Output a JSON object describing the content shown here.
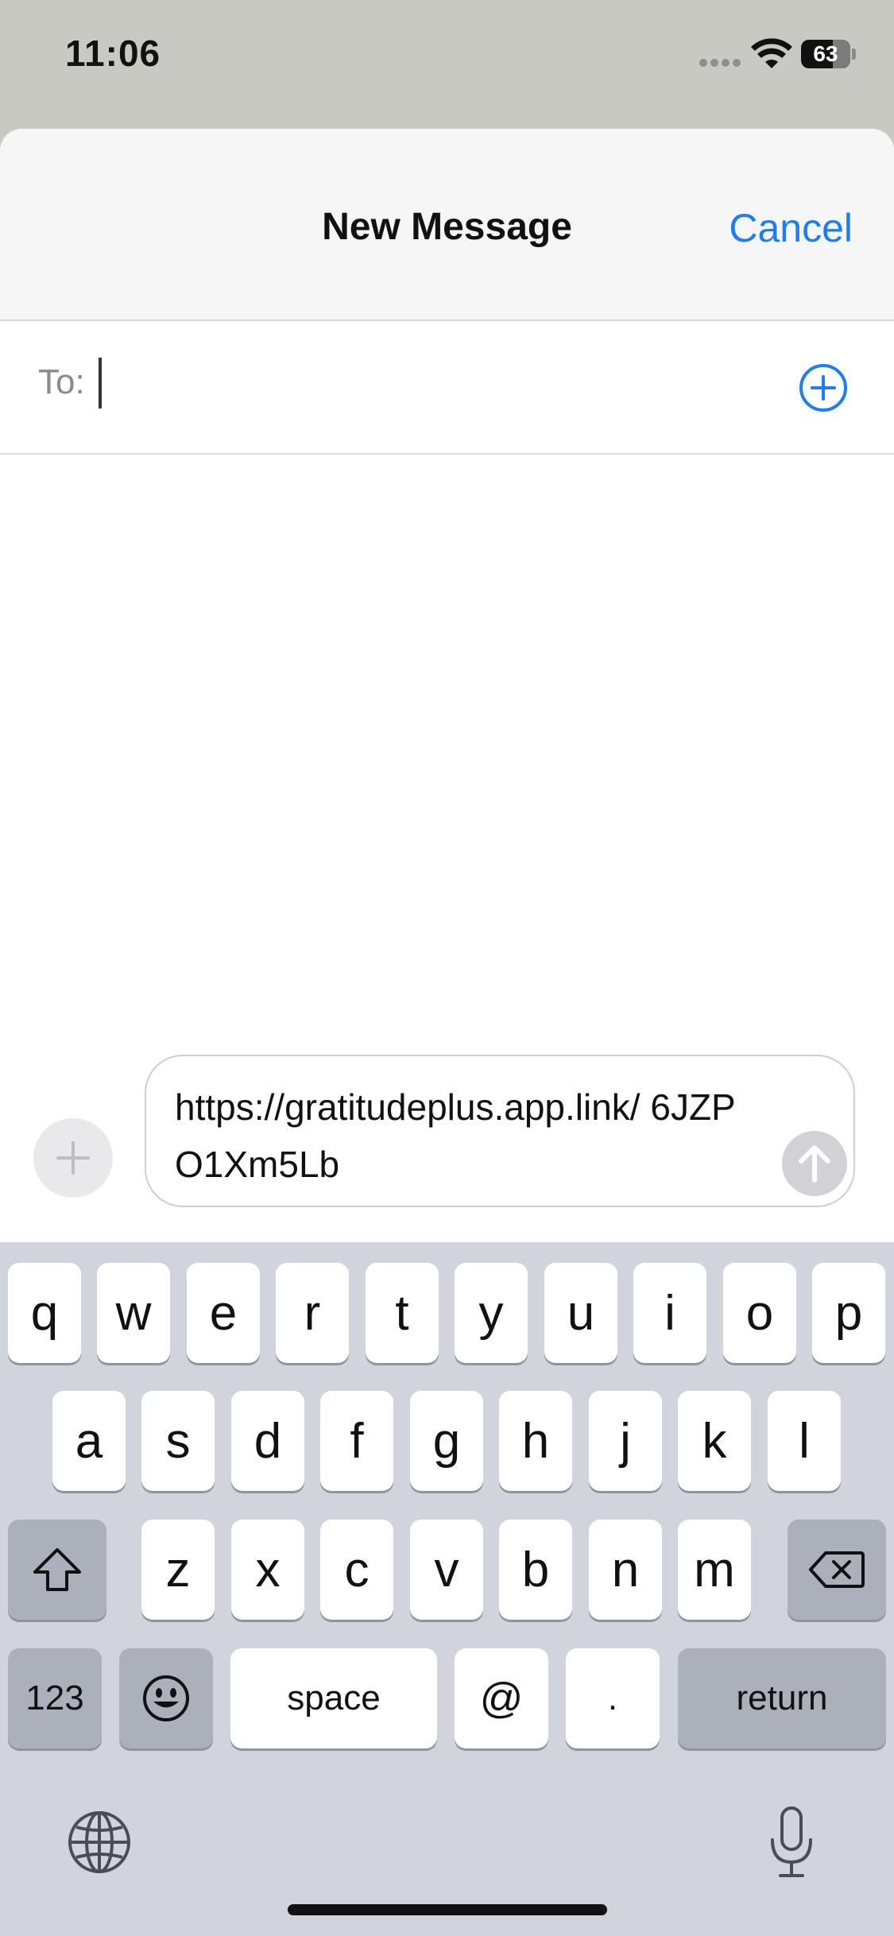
{
  "status_bar": {
    "time": "11:06",
    "battery": "63"
  },
  "navbar": {
    "title": "New Message",
    "cancel_label": "Cancel"
  },
  "to_field": {
    "label": "To:",
    "value": ""
  },
  "composer": {
    "message_text": "https://gratitudeplus.app.link/ 6JZPO1Xm5Lb"
  },
  "keyboard": {
    "row1": [
      "q",
      "w",
      "e",
      "r",
      "t",
      "y",
      "u",
      "i",
      "o",
      "p"
    ],
    "row2": [
      "a",
      "s",
      "d",
      "f",
      "g",
      "h",
      "j",
      "k",
      "l"
    ],
    "row3": [
      "z",
      "x",
      "c",
      "v",
      "b",
      "n",
      "m"
    ],
    "numbers_label": "123",
    "space_label": "space",
    "at_label": "@",
    "period_label": ".",
    "return_label": "return"
  },
  "icons": {
    "add_contact": "plus-circle-icon",
    "apps": "plus-icon",
    "send": "arrow-up-icon",
    "shift": "shift-icon",
    "delete": "delete-icon",
    "emoji": "emoji-icon",
    "globe": "globe-icon",
    "mic": "microphone-icon"
  },
  "colors": {
    "accent": "#1d7ef3",
    "keyboard_bg": "#d1d4da",
    "dark_key": "#abb0ba"
  }
}
